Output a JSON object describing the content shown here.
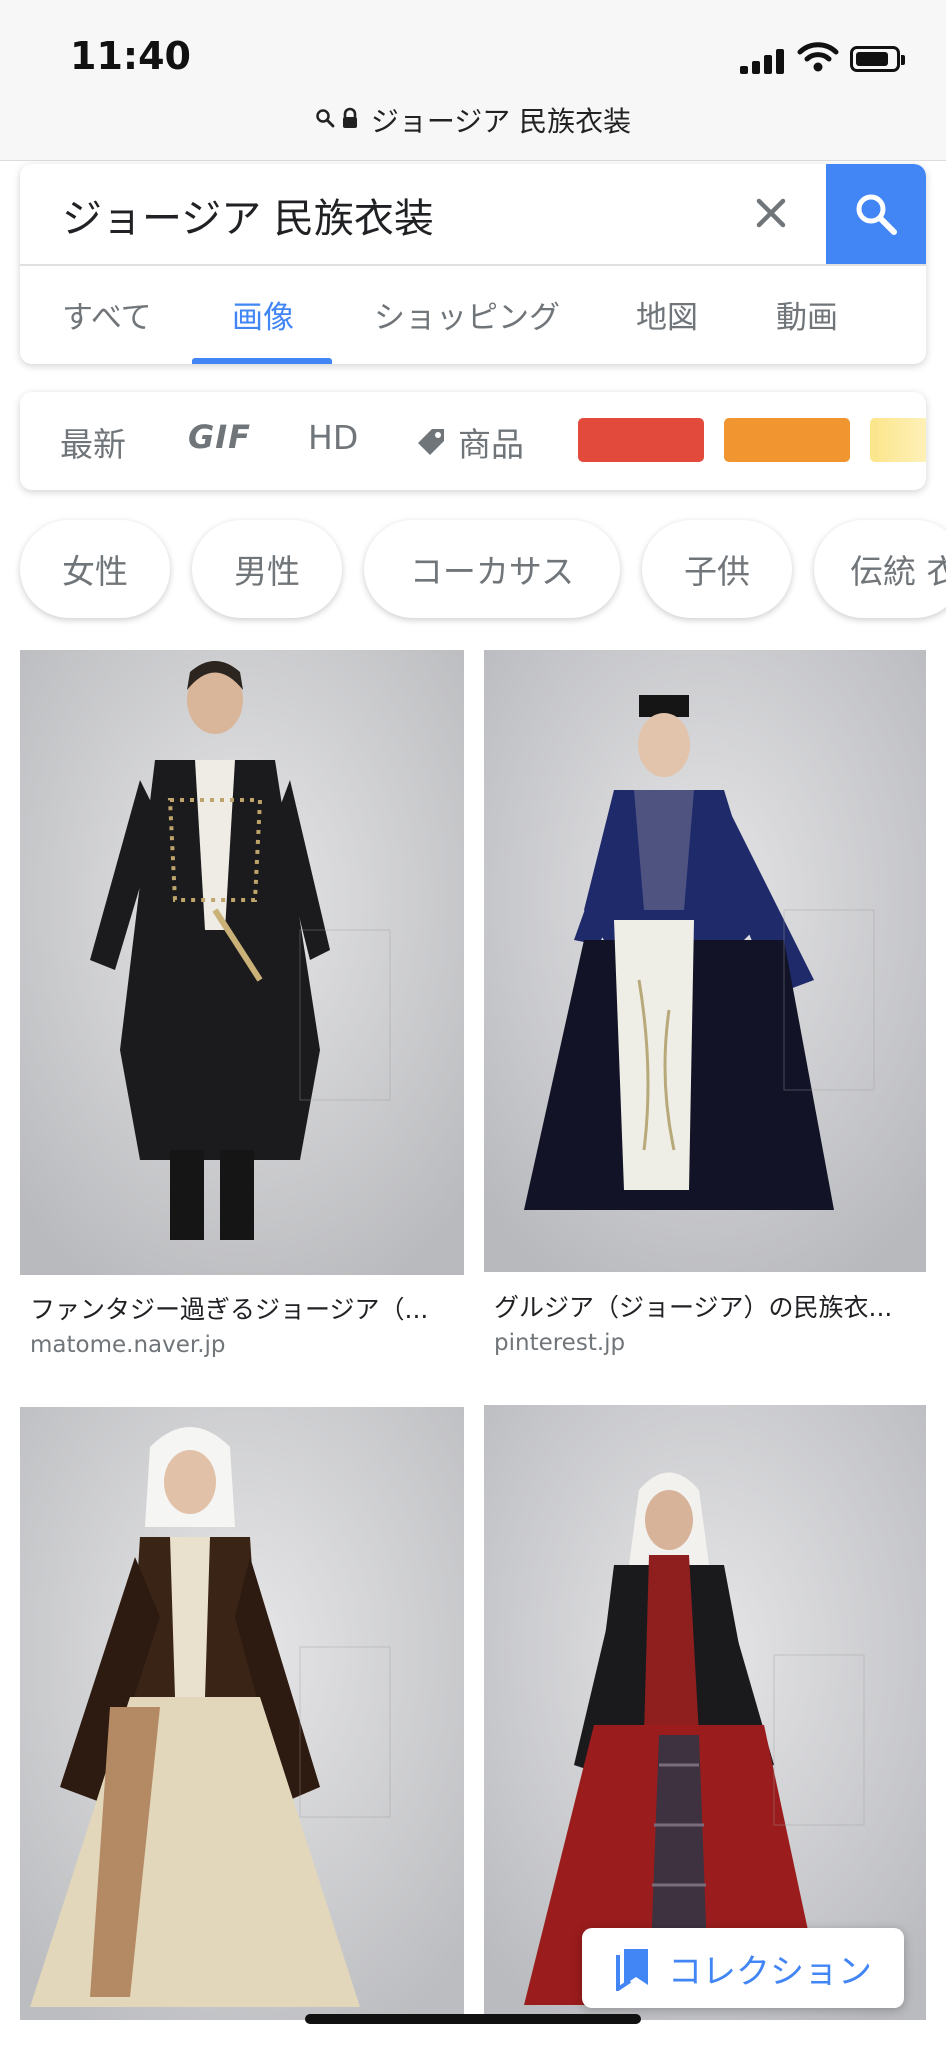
{
  "status_bar": {
    "time": "11:40",
    "signal_icon": "cellular-signal-icon",
    "wifi_icon": "wifi-icon",
    "battery_icon": "battery-icon"
  },
  "url_bar": {
    "search_icon": "search-icon",
    "lock_icon": "lock-icon",
    "text": "ジョージア 民族衣装"
  },
  "search": {
    "query": "ジョージア 民族衣装",
    "clear_icon": "close-icon",
    "submit_icon": "search-icon",
    "accent_color": "#4285f4"
  },
  "tabs": [
    {
      "label": "すべて",
      "active": false
    },
    {
      "label": "画像",
      "active": true
    },
    {
      "label": "ショッピング",
      "active": false
    },
    {
      "label": "地図",
      "active": false
    },
    {
      "label": "動画",
      "active": false
    }
  ],
  "tools": {
    "latest": "最新",
    "gif": "GIF",
    "hd": "HD",
    "product_icon": "tag-icon",
    "product": "商品",
    "color_swatches": [
      "#e24a3b",
      "#f0952f",
      "#f7e38b"
    ]
  },
  "chips": [
    "女性",
    "男性",
    "コーカサス",
    "子供",
    "伝統 衣"
  ],
  "results": [
    {
      "caption": "ファンタジー過ぎるジョージア（...",
      "source": "matome.naver.jp"
    },
    {
      "caption": "グルジア（ジョージア）の民族衣...",
      "source": "pinterest.jp"
    },
    {
      "caption": "",
      "source": ""
    },
    {
      "caption": "",
      "source": ""
    }
  ],
  "collection_button": {
    "icon": "bookmark-icon",
    "label": "コレクション"
  }
}
